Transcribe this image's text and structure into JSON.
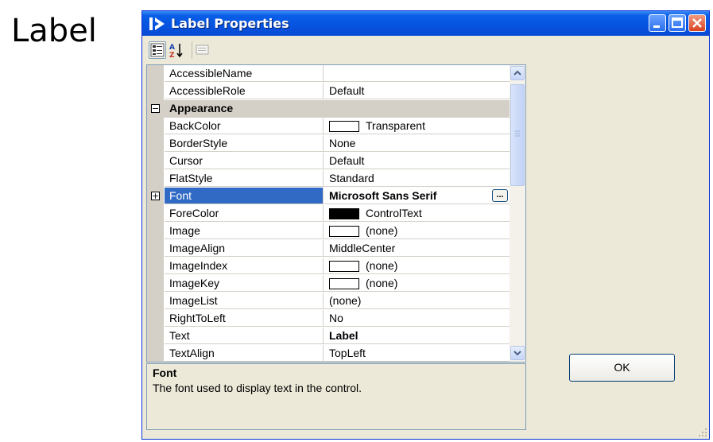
{
  "page_label": "Label",
  "window": {
    "title": "Label Properties",
    "ok_label": "OK"
  },
  "toolbar": {
    "buttons": [
      "categorized-icon",
      "alphabetical-icon",
      "property-pages-icon"
    ],
    "sort_glyph": "A\nZ"
  },
  "properties": [
    {
      "name": "AccessibleName",
      "value": ""
    },
    {
      "name": "AccessibleRole",
      "value": "Default"
    },
    {
      "name": "Appearance",
      "value": "",
      "category": true
    },
    {
      "name": "BackColor",
      "value": "Transparent",
      "swatch": "white"
    },
    {
      "name": "BorderStyle",
      "value": "None"
    },
    {
      "name": "Cursor",
      "value": "Default"
    },
    {
      "name": "FlatStyle",
      "value": "Standard"
    },
    {
      "name": "Font",
      "value": "Microsoft Sans Serif",
      "bold": true,
      "expandable": true,
      "selected": true,
      "ellipsis": "..."
    },
    {
      "name": "ForeColor",
      "value": "ControlText",
      "swatch": "black"
    },
    {
      "name": "Image",
      "value": "(none)",
      "swatch": "white"
    },
    {
      "name": "ImageAlign",
      "value": "MiddleCenter"
    },
    {
      "name": "ImageIndex",
      "value": "(none)",
      "swatch": "white"
    },
    {
      "name": "ImageKey",
      "value": "(none)",
      "swatch": "white"
    },
    {
      "name": "ImageList",
      "value": "(none)"
    },
    {
      "name": "RightToLeft",
      "value": "No"
    },
    {
      "name": "Text",
      "value": "Label",
      "bold": true
    },
    {
      "name": "TextAlign",
      "value": "TopLeft"
    }
  ],
  "description": {
    "title": "Font",
    "text": "The font used to display text in the control."
  },
  "colors": {
    "titlebar": "#0553e0",
    "selection": "#316ac5",
    "window_bg": "#ece9d8"
  }
}
